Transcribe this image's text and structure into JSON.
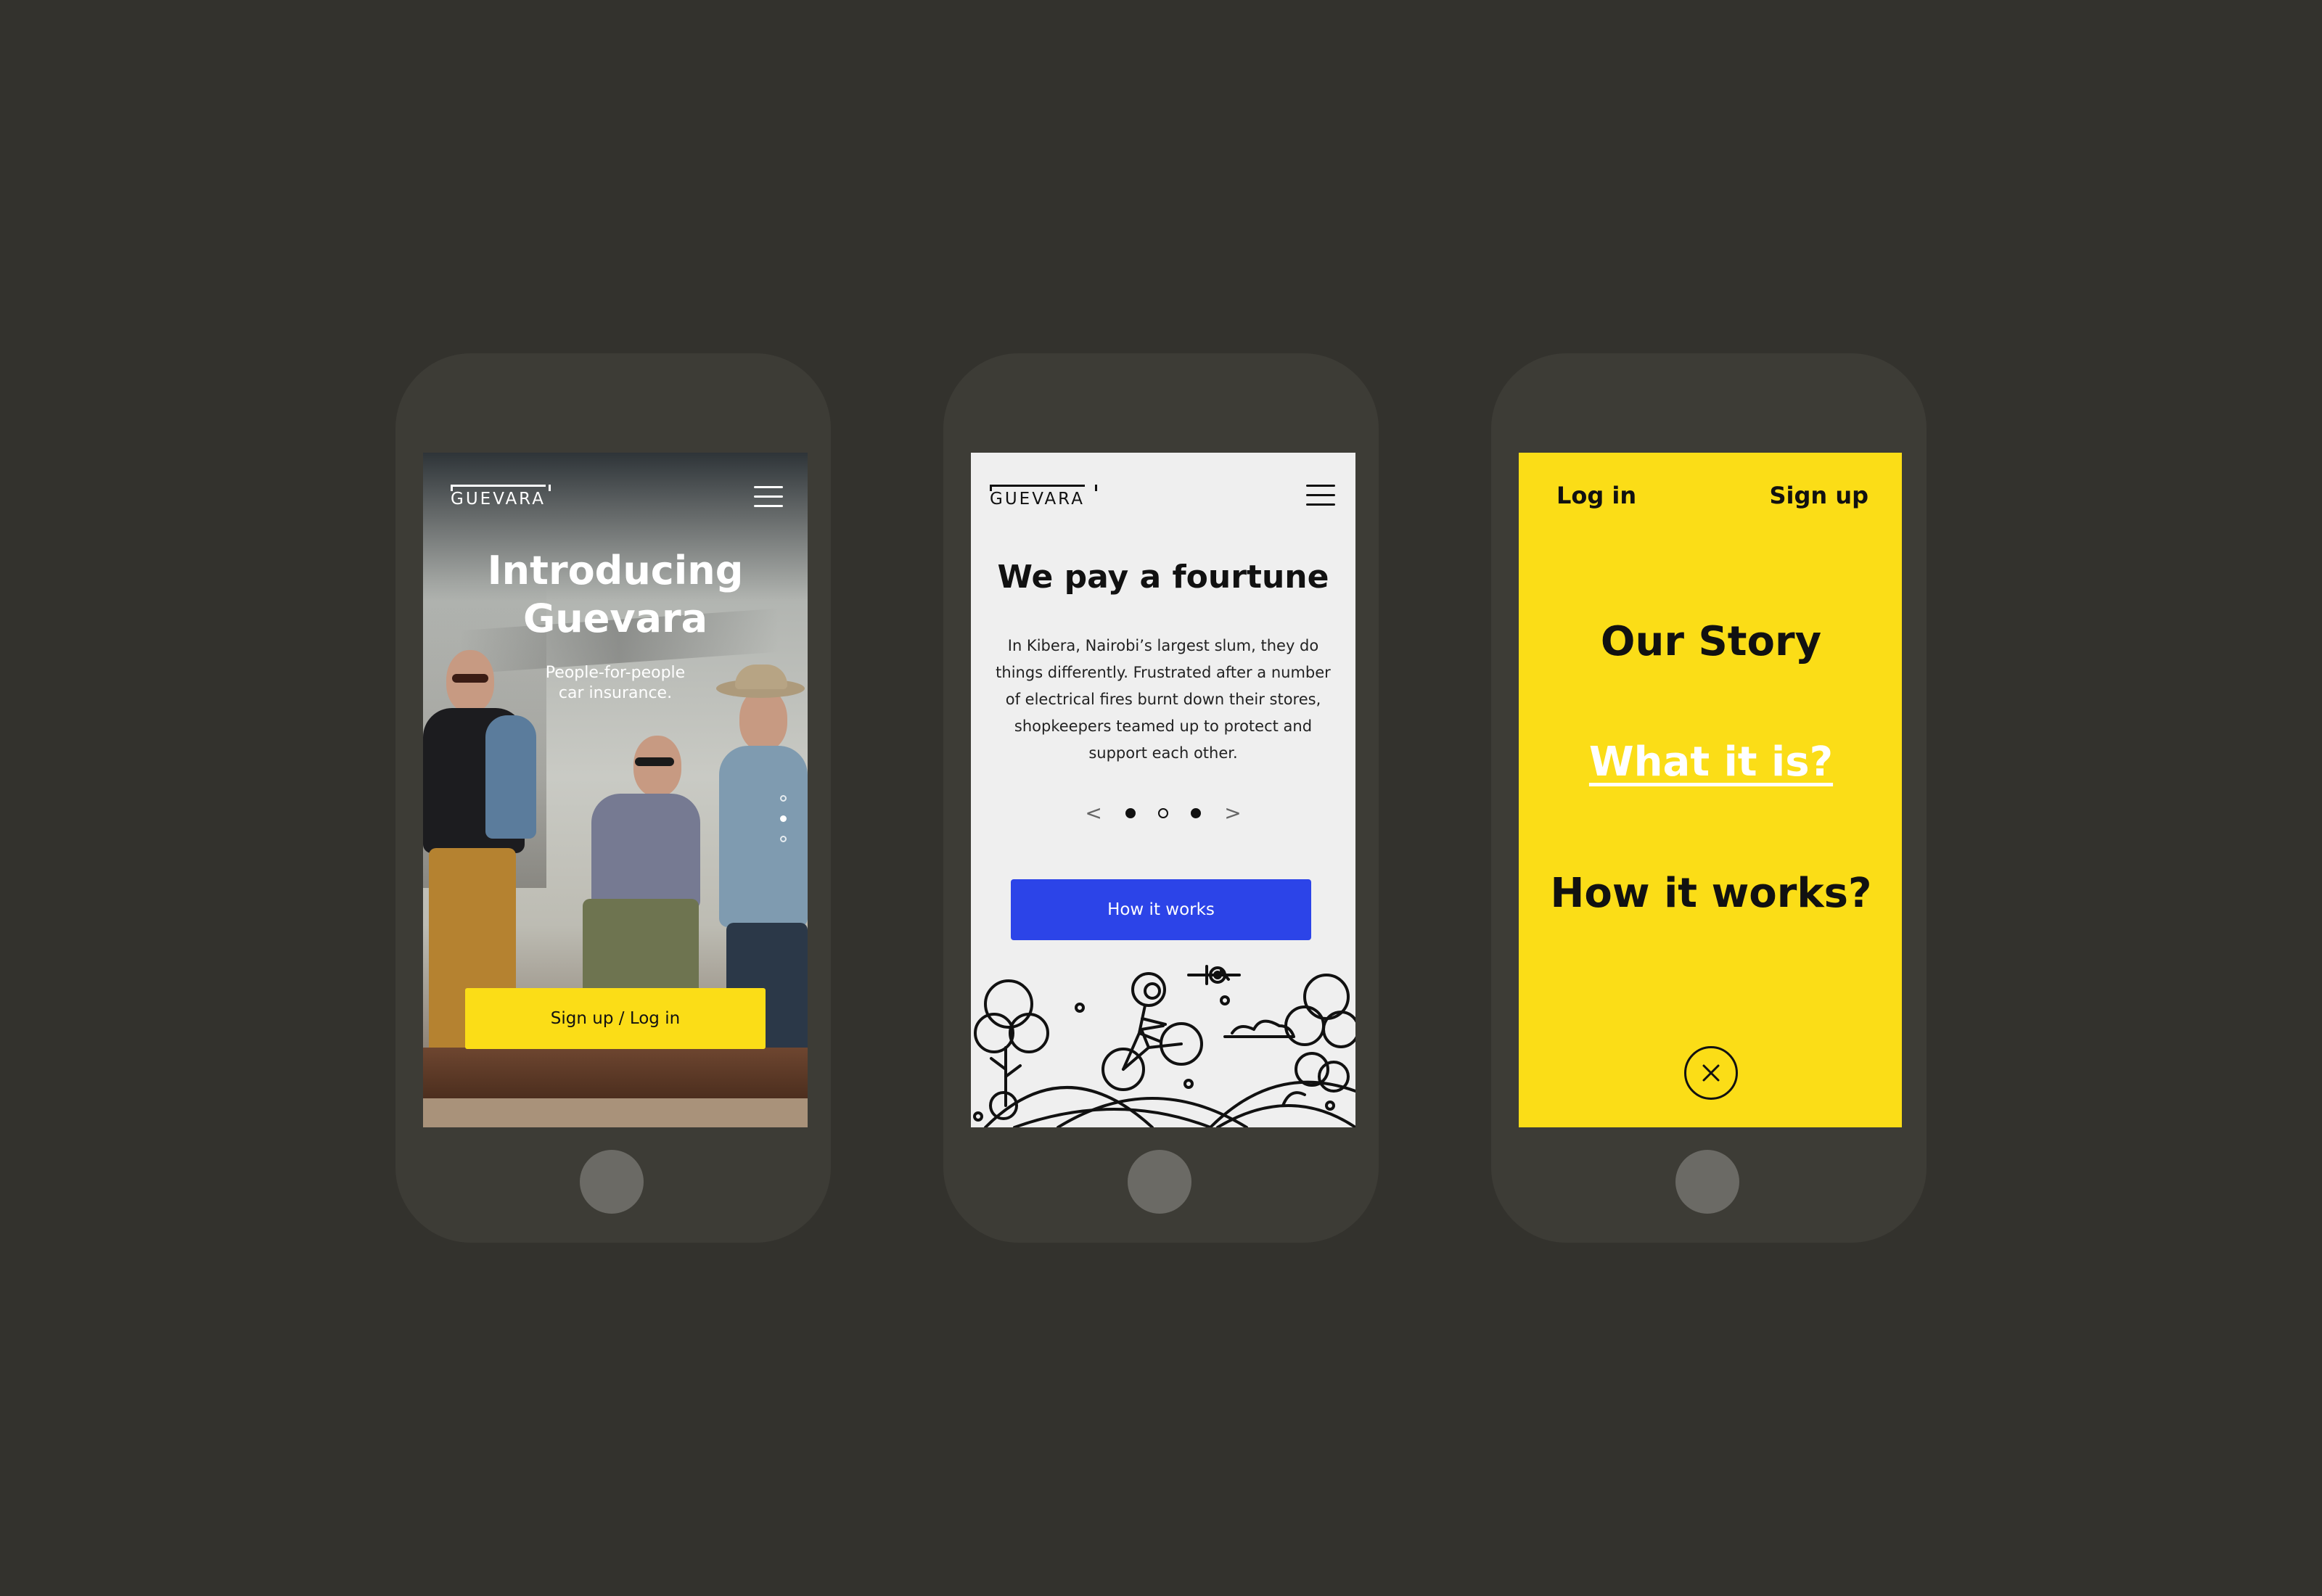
{
  "colors": {
    "background": "#33322d",
    "phone_body": "#3d3c36",
    "home_button": "#6b6a65",
    "accent_yellow": "#fbdd17",
    "accent_blue": "#2c44e8",
    "screen_light": "#efefef"
  },
  "screen1": {
    "logo": "GUEVARA",
    "title": "Introducing Guevara",
    "subtitle_line1": "People-for-people",
    "subtitle_line2": "car insurance.",
    "cta_label": "Sign up / Log in",
    "menu_icon": "hamburger-menu-icon"
  },
  "screen2": {
    "logo": "GUEVARA",
    "title": "We pay a fourtune",
    "body": "In Kibera, Nairobi’s largest slum, they do things differently. Frustrated after a number of electrical fires burnt down their stores, shopkeepers teamed up to protect and support each other.",
    "prev_arrow": "<",
    "next_arrow": ">",
    "cta_label": "How it works",
    "menu_icon": "hamburger-menu-icon"
  },
  "screen3": {
    "login_label": "Log in",
    "signup_label": "Sign up",
    "nav": [
      "Our Story",
      "What it is?",
      "How it works?"
    ],
    "close_icon": "close-x-icon"
  }
}
